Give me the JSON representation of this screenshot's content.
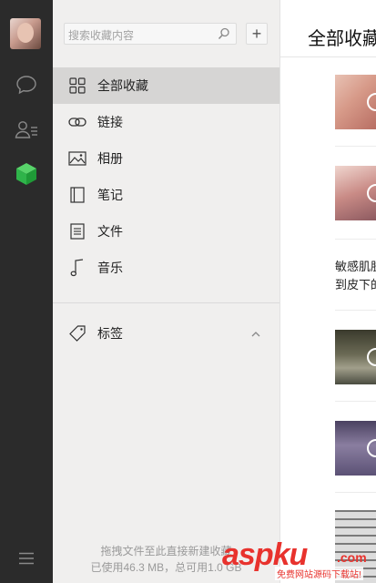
{
  "rail": {
    "icons": [
      "chat-icon",
      "contacts-icon",
      "favorites-cube-icon",
      "menu-icon"
    ],
    "accent": "#2fb44a"
  },
  "panel": {
    "search_placeholder": "搜索收藏内容",
    "add_label": "+",
    "nav": [
      {
        "label": "全部收藏",
        "icon": "grid-icon",
        "active": true
      },
      {
        "label": "链接",
        "icon": "link-icon"
      },
      {
        "label": "相册",
        "icon": "image-icon"
      },
      {
        "label": "笔记",
        "icon": "note-icon"
      },
      {
        "label": "文件",
        "icon": "file-icon"
      },
      {
        "label": "音乐",
        "icon": "music-icon"
      }
    ],
    "tags_label": "标签",
    "footer_hint": "拖拽文件至此直接新建收藏",
    "footer_storage": "已使用46.3 MB，总可用1.0 GB"
  },
  "content": {
    "title": "全部收藏",
    "text_item": [
      "敏感肌肤",
      "到皮下的"
    ]
  },
  "watermark": {
    "main": "aspku",
    "tld": ".com",
    "sub": "免费网站源码下载站!"
  }
}
